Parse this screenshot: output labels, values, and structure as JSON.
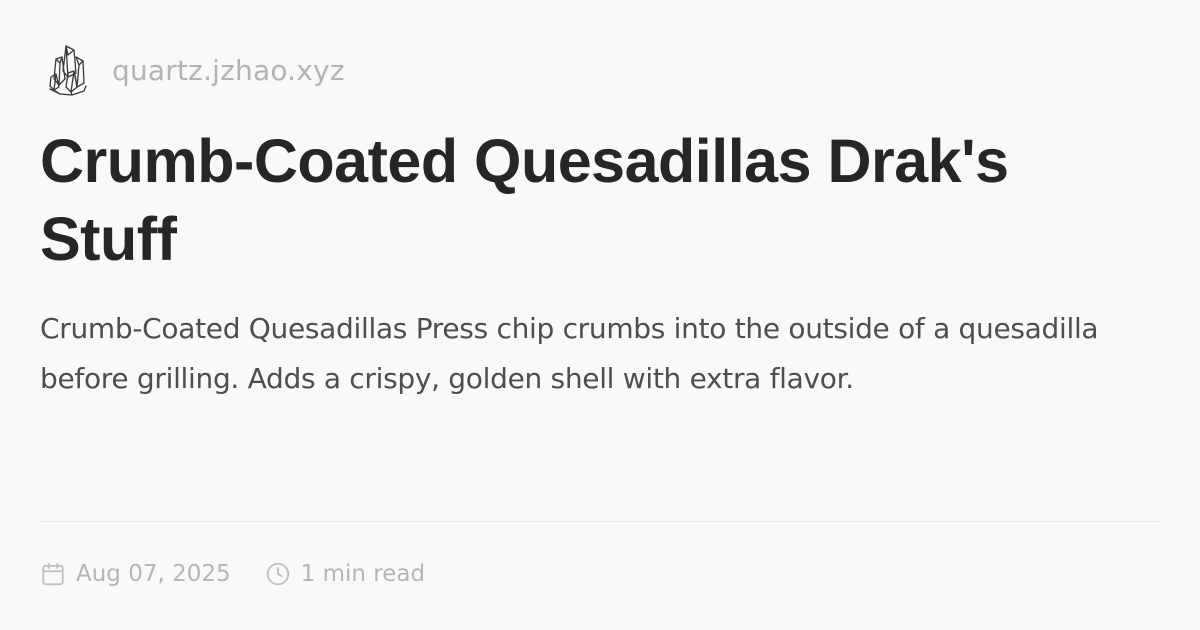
{
  "site": {
    "domain": "quartz.jzhao.xyz",
    "logo_icon": "crystal-icon"
  },
  "page": {
    "title": "Crumb-Coated Quesadillas Drak's Stuff",
    "description": "Crumb-Coated Quesadillas Press chip crumbs into the outside of a quesadilla before grilling. Adds a crispy, golden shell with extra flavor."
  },
  "meta": {
    "date_icon": "calendar-icon",
    "date": "Aug 07, 2025",
    "reading_time_icon": "clock-icon",
    "reading_time": "1 min read"
  },
  "colors": {
    "background": "#faf9fa",
    "title": "#262626",
    "description": "#4e4e4e",
    "muted": "#b5b5b5",
    "divider": "#e8e8e8"
  }
}
